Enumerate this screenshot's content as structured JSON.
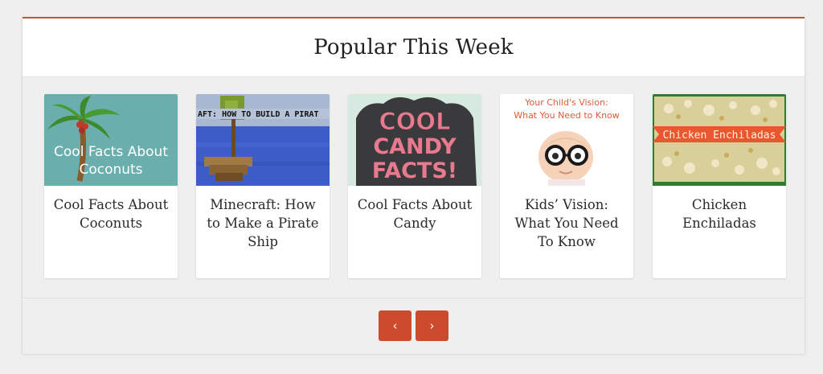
{
  "widget": {
    "title": "Popular This Week"
  },
  "cards": [
    {
      "title": "Cool Facts About Coconuts",
      "image_text": [
        "Cool Facts About",
        "Coconuts"
      ]
    },
    {
      "title": "Minecraft: How to Make a Pirate Ship",
      "image_text": "AFT: HOW TO BUILD A PIRAT"
    },
    {
      "title": "Cool Facts About Candy",
      "image_text": [
        "COOL",
        "CANDY",
        "FACTS!"
      ]
    },
    {
      "title": "Kids’ Vision: What You Need To Know",
      "image_text": [
        "Your Child's Vision:",
        "What You Need to Know"
      ]
    },
    {
      "title": "Chicken Enchiladas",
      "image_text": "Chicken Enchiladas"
    }
  ],
  "pagination": {
    "prev_icon": "‹",
    "next_icon": "›"
  },
  "colors": {
    "accent": "#cc4a2d",
    "header_rule": "#c0583a"
  }
}
